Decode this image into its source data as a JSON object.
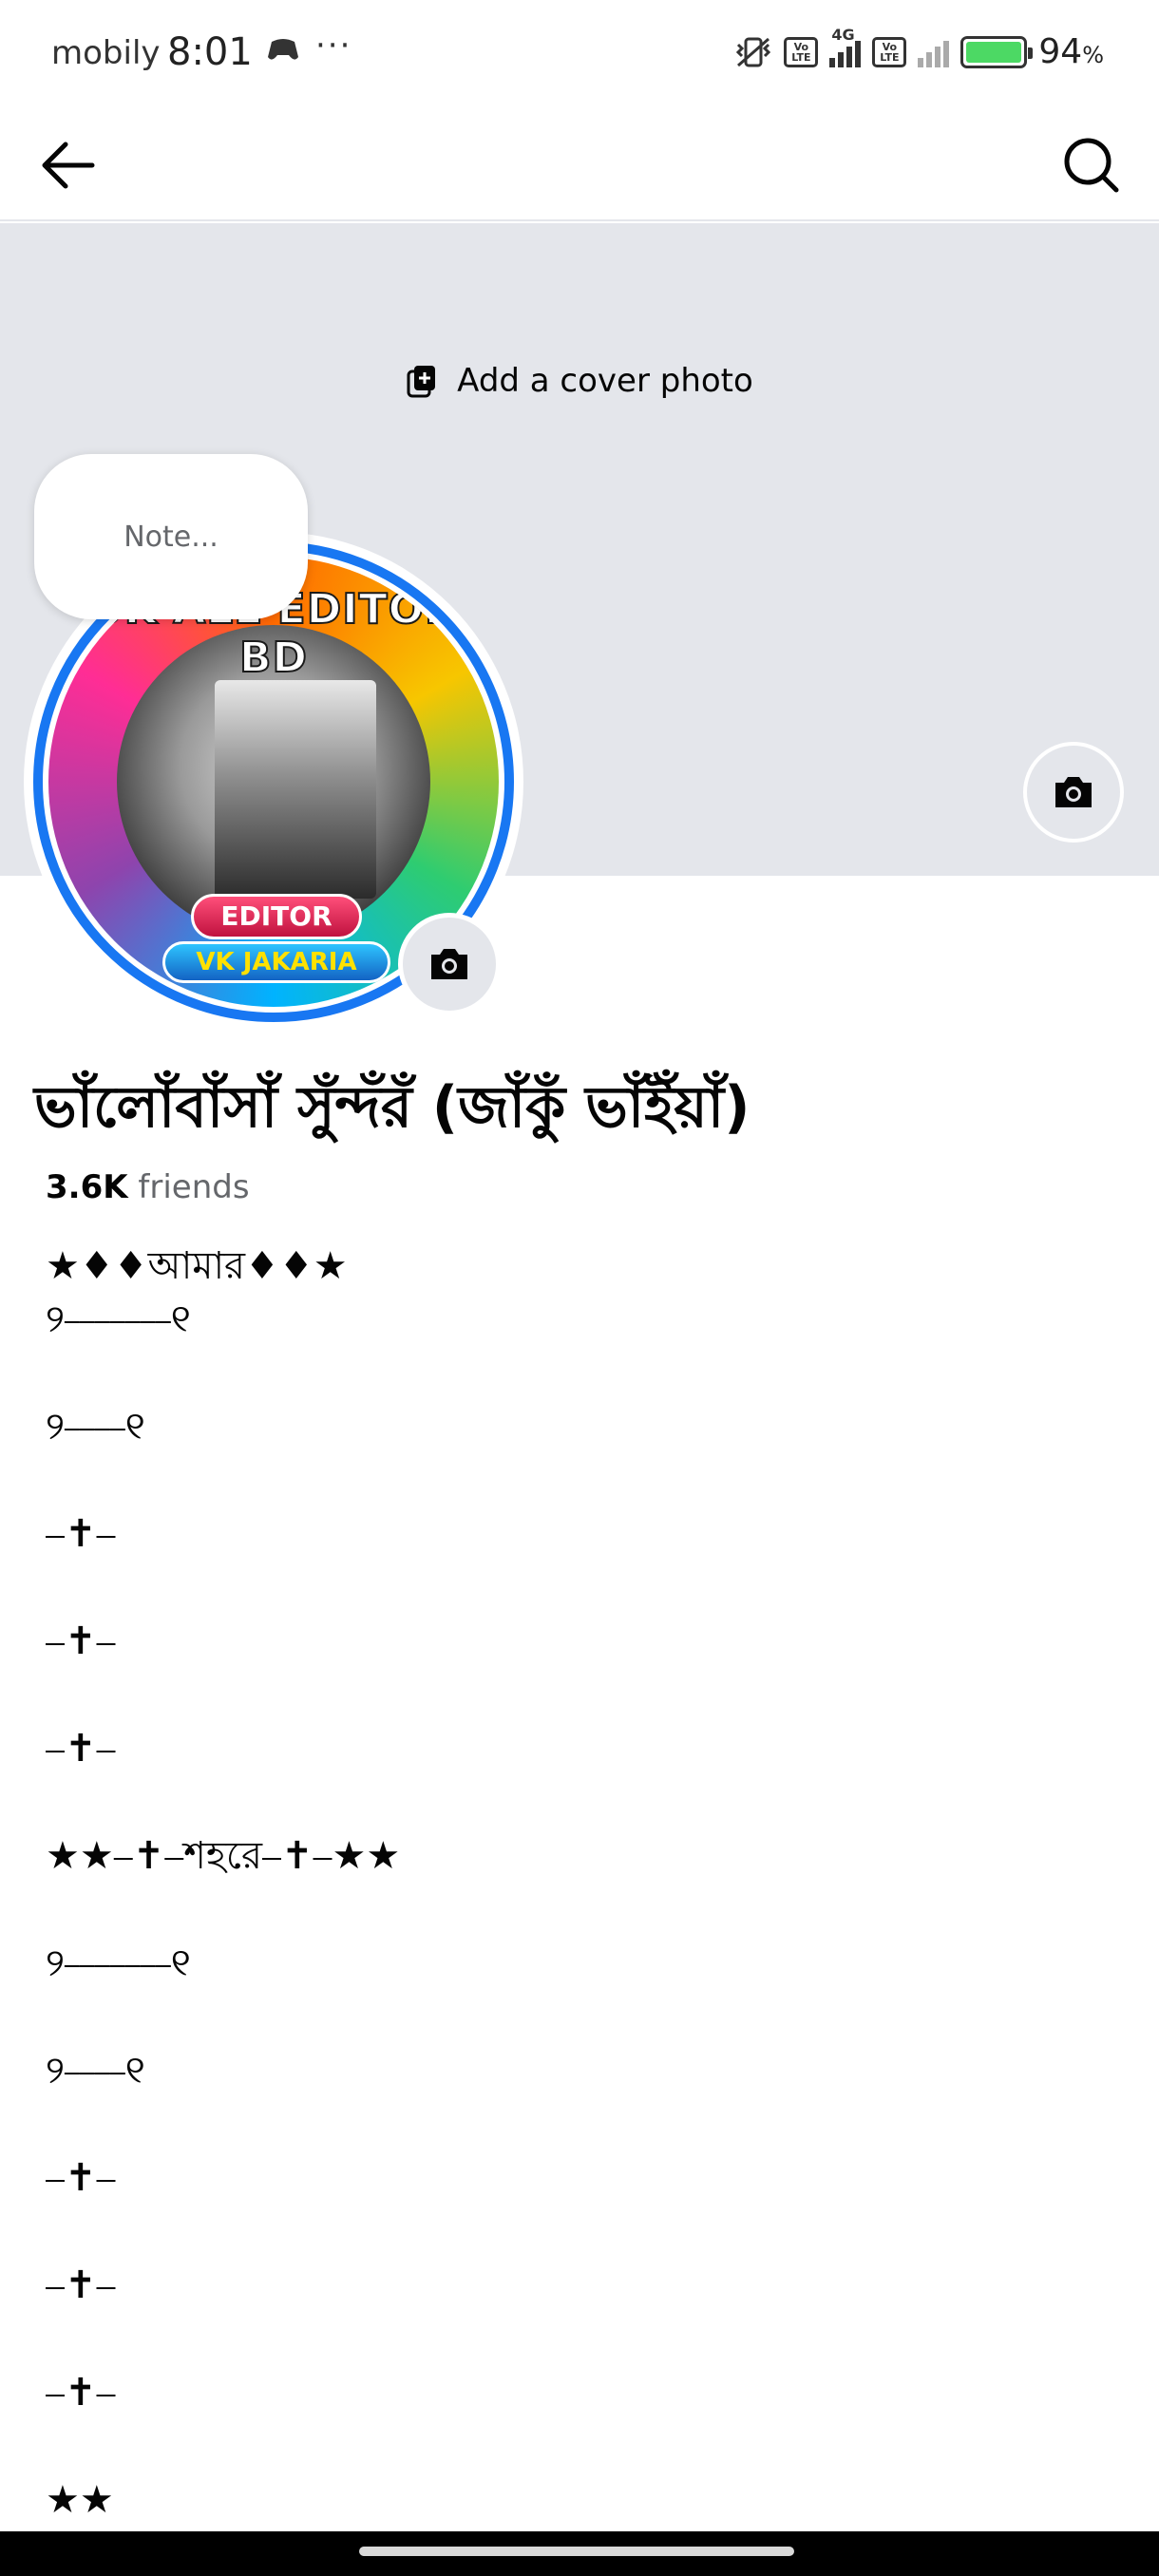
{
  "status_bar": {
    "carrier": "mobily",
    "time": "8:01",
    "more": "···",
    "network": "4G",
    "volte_label": "Vo LTE",
    "battery": "94",
    "battery_unit": "%"
  },
  "nav": {
    "back_icon": "arrow-left-icon",
    "search_icon": "search-icon"
  },
  "cover": {
    "add_cover_label": "Add a cover photo"
  },
  "note": {
    "placeholder": "Note..."
  },
  "avatar": {
    "badge_top": "UK ALL EDITOR BD",
    "badge_editor": "EDITOR",
    "badge_name": "VK JAKARIA"
  },
  "profile": {
    "name": "ভাঁলোঁবাঁসাঁ সুঁন্দঁরঁ (জাঁকুঁ ভাঁইঁয়াঁ)",
    "friends_count": "3.6K",
    "friends_label": "friends"
  },
  "bio": {
    "lines": [
      "★♦♦￼￼আমার￼￼♦♦★",
      "୨⎯⎯⎯⎯⎯⎯⎯୧",
      "",
      "୨⎯⎯⎯⎯୧",
      "",
      "⎯✝⎯",
      "",
      "⎯✝⎯",
      "",
      "⎯✝⎯",
      "",
      "★￼★⎯✝⎯￼শহরে￼⎯✝⎯★￼★",
      "",
      "୨⎯⎯⎯⎯⎯⎯⎯୧",
      "",
      "୨⎯⎯⎯⎯୧",
      "",
      "⎯✝⎯",
      "",
      "⎯✝⎯",
      "",
      "⎯✝⎯",
      "",
      "★￼★"
    ]
  }
}
